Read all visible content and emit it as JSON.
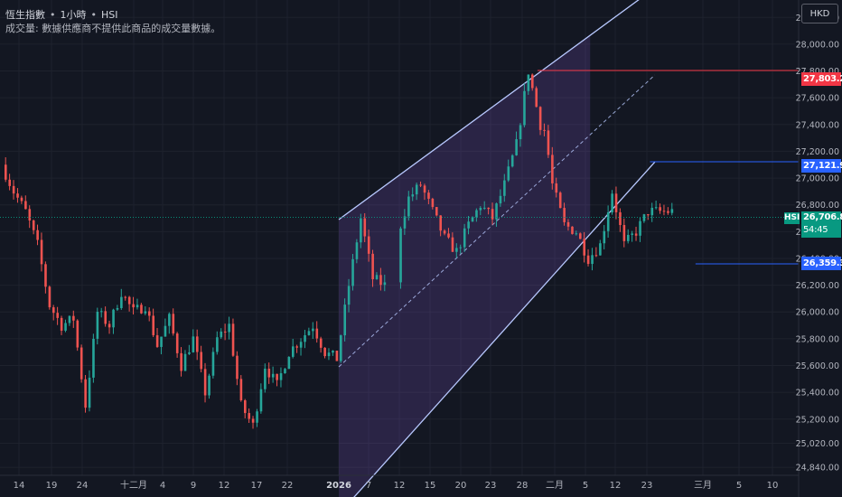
{
  "legend": {
    "symbol_name": "恆生指數",
    "interval": "1小時",
    "ticker": "HSI",
    "volume_note": "成交量: 數據供應商不提供此商品的成交量數據。"
  },
  "currency_button": "HKD",
  "price_labels": {
    "upper_line": "27,803.27",
    "mid_line": "27,121.93",
    "lower_line": "26,359.31",
    "last_price": "26,706.89",
    "countdown": "54:45",
    "series_tag": "HSI"
  },
  "colors": {
    "background": "#131722",
    "up": "#26a69a",
    "down": "#ef5350",
    "red_line": "#f23645",
    "blue_line": "#2962ff",
    "channel_line": "#b8c9ff",
    "channel_fill": "#7e57c2",
    "last_price": "#089981"
  },
  "chart_data": {
    "type": "candlestick",
    "symbol": "HSI",
    "y_axis": {
      "range": [
        24780,
        28330
      ],
      "ticks": [
        "28,200.00",
        "28,000.00",
        "27,800.00",
        "27,600.00",
        "27,400.00",
        "27,200.00",
        "27,000.00",
        "26,800.00",
        "26,600.00",
        "26,400.00",
        "26,200.00",
        "26,000.00",
        "25,800.00",
        "25,600.00",
        "25,400.00",
        "25,200.00",
        "25,020.00",
        "24,840.00"
      ],
      "tick_values": [
        28200,
        28000,
        27800,
        27600,
        27400,
        27200,
        27000,
        26800,
        26600,
        26400,
        26200,
        26000,
        25800,
        25600,
        25400,
        25200,
        25020,
        24840
      ]
    },
    "x_axis": {
      "labels": [
        "14",
        "19",
        "24",
        "十二月",
        "4",
        "9",
        "12",
        "17",
        "22",
        "2026",
        "7",
        "12",
        "15",
        "20",
        "23",
        "28",
        "二月",
        "5",
        "12",
        "23",
        "三月",
        "5",
        "10"
      ],
      "label_pos": [
        21,
        57,
        91,
        148,
        180,
        214,
        248,
        284,
        318,
        375,
        408,
        442,
        476,
        510,
        543,
        578,
        614,
        648,
        681,
        716,
        778,
        818,
        855
      ]
    },
    "horizontal_lines": [
      {
        "price": 27803.27,
        "color": "red",
        "from_day": 22.3
      },
      {
        "price": 27121.93,
        "color": "blue",
        "from_day": 27.0
      },
      {
        "price": 26359.31,
        "color": "blue",
        "from_day": 28.9
      }
    ],
    "parallel_channel": {
      "upper": {
        "start": [
          14.0,
          26690
        ],
        "end": [
          27.2,
          28420
        ]
      },
      "middle": {
        "start": [
          14.0,
          25590
        ],
        "end": [
          27.2,
          27770
        ]
      },
      "lower": {
        "start": [
          14.0,
          24490
        ],
        "end": [
          27.2,
          27120
        ]
      },
      "fill_end_day": 24.5
    },
    "last_price": 26706.89,
    "day_count": 28,
    "bars_per_day": 6,
    "anchors": [
      [
        0,
        27100
      ],
      [
        0.5,
        26900
      ],
      [
        1,
        26750
      ],
      [
        1.5,
        26500
      ],
      [
        2,
        26050
      ],
      [
        2.5,
        25900
      ],
      [
        3,
        25950
      ],
      [
        3.5,
        25300
      ],
      [
        4,
        26000
      ],
      [
        4.5,
        25900
      ],
      [
        5,
        26150
      ],
      [
        5.5,
        26000
      ],
      [
        6,
        26050
      ],
      [
        6.5,
        25750
      ],
      [
        7,
        25950
      ],
      [
        7.5,
        25600
      ],
      [
        8,
        25800
      ],
      [
        8.5,
        25400
      ],
      [
        9,
        25800
      ],
      [
        9.5,
        25900
      ],
      [
        10,
        25300
      ],
      [
        10.5,
        25150
      ],
      [
        11,
        25600
      ],
      [
        11.5,
        25450
      ],
      [
        12,
        25700
      ],
      [
        12.5,
        25800
      ],
      [
        13,
        25900
      ],
      [
        13.5,
        25700
      ],
      [
        14,
        25650
      ],
      [
        14.5,
        26200
      ],
      [
        15,
        26700
      ],
      [
        15.5,
        26250
      ],
      [
        16,
        26200
      ],
      [
        16.5,
        26550
      ],
      [
        17,
        26850
      ],
      [
        17.5,
        26950
      ],
      [
        18,
        26750
      ],
      [
        18.5,
        26550
      ],
      [
        19,
        26450
      ],
      [
        19.5,
        26650
      ],
      [
        20,
        26800
      ],
      [
        20.5,
        26700
      ],
      [
        21,
        26950
      ],
      [
        21.5,
        27250
      ],
      [
        22,
        27800
      ],
      [
        22.5,
        27400
      ],
      [
        22.7,
        27350
      ],
      [
        23.0,
        26950
      ],
      [
        23.5,
        26650
      ],
      [
        24,
        26600
      ],
      [
        24.5,
        26400
      ],
      [
        25,
        26500
      ],
      [
        25.5,
        26900
      ],
      [
        26,
        26500
      ],
      [
        26.5,
        26600
      ],
      [
        27,
        26750
      ]
    ]
  }
}
